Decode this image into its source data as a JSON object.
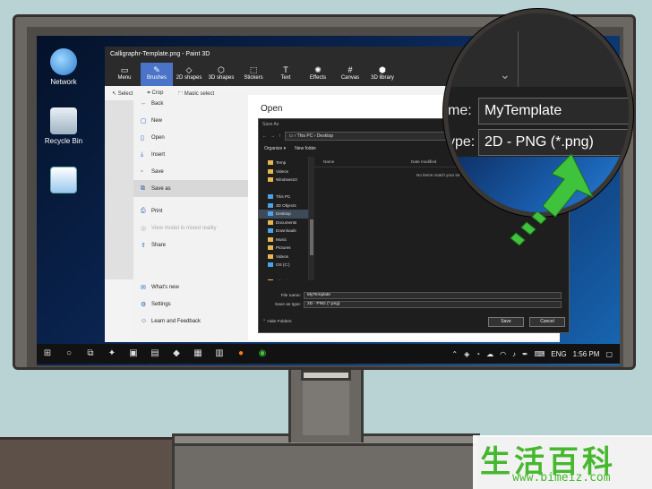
{
  "desktop": {
    "icons": [
      {
        "label": "Network"
      },
      {
        "label": "Recycle Bin"
      },
      {
        "label": ""
      }
    ]
  },
  "paint3d": {
    "title": "Calligraphr-Template.png - Paint 3D",
    "ribbon": [
      {
        "label": "Menu",
        "icon": "folder-icon"
      },
      {
        "label": "Brushes",
        "icon": "brush-icon",
        "active": true
      },
      {
        "label": "2D shapes",
        "icon": "shapes-icon"
      },
      {
        "label": "3D shapes",
        "icon": "cube-icon"
      },
      {
        "label": "Stickers",
        "icon": "sticker-icon"
      },
      {
        "label": "Text",
        "icon": "text-icon"
      },
      {
        "label": "Effects",
        "icon": "effects-icon"
      },
      {
        "label": "Canvas",
        "icon": "canvas-icon"
      },
      {
        "label": "3D library",
        "icon": "library-icon"
      }
    ],
    "tools": {
      "select": "Select",
      "crop": "Crop",
      "magic_select": "Magic select"
    }
  },
  "file_menu": {
    "items": [
      {
        "label": "Back",
        "icon": "back-arrow-icon"
      },
      {
        "label": "New",
        "icon": "new-file-icon"
      },
      {
        "label": "Open",
        "icon": "open-file-icon"
      },
      {
        "label": "Insert",
        "icon": "insert-icon"
      },
      {
        "label": "Save",
        "icon": "save-icon"
      },
      {
        "label": "Save as",
        "icon": "save-as-icon",
        "active": true
      },
      {
        "label": "Print",
        "icon": "print-icon"
      },
      {
        "label": "View model in mixed reality",
        "icon": "mixed-reality-icon",
        "disabled": true
      },
      {
        "label": "Share",
        "icon": "share-icon"
      },
      {
        "label": "What's new",
        "icon": "whats-new-icon"
      },
      {
        "label": "Settings",
        "icon": "settings-icon"
      },
      {
        "label": "Learn and Feedback",
        "icon": "feedback-icon"
      }
    ],
    "open_panel_title": "Open"
  },
  "save_dialog": {
    "title": "Save As",
    "path": [
      "This PC",
      "Desktop"
    ],
    "toolbar": {
      "organize": "Organize ▾",
      "new_folder": "New folder"
    },
    "nav": [
      {
        "label": "Temp",
        "kind": "folder"
      },
      {
        "label": "Videos",
        "kind": "folder"
      },
      {
        "label": "Windows10",
        "kind": "folder"
      },
      {
        "label": "",
        "kind": "spacer"
      },
      {
        "label": "This PC",
        "kind": "pc"
      },
      {
        "label": "3D Objects",
        "kind": "blue"
      },
      {
        "label": "Desktop",
        "kind": "blue",
        "selected": true
      },
      {
        "label": "Documents",
        "kind": "folder"
      },
      {
        "label": "Downloads",
        "kind": "blue"
      },
      {
        "label": "Music",
        "kind": "folder"
      },
      {
        "label": "Pictures",
        "kind": "folder"
      },
      {
        "label": "Videos",
        "kind": "folder"
      },
      {
        "label": "OS (C:)",
        "kind": "blue"
      },
      {
        "label": "",
        "kind": "spacer"
      },
      {
        "label": "Libraries",
        "kind": "folder"
      }
    ],
    "columns": {
      "name": "Name",
      "date_modified": "Date modified"
    },
    "empty_message": "No items match your se",
    "file_name_label": "File name:",
    "file_name_value": "MyTemplate",
    "save_type_label": "Save as type:",
    "save_type_value": "2D - PNG (*.png)",
    "hide_folders": "Hide Folders",
    "save_button": "Save",
    "cancel_button": "Cancel"
  },
  "taskbar": {
    "language": "ENG",
    "time": "1:56 PM"
  },
  "magnifier": {
    "name_label": "me:",
    "name_value": "MyTemplate",
    "type_label": "ype:",
    "type_value": "2D - PNG (*.png)"
  },
  "watermark": {
    "chinese": "生活百科",
    "url": "www.bimeiz.com"
  },
  "colors": {
    "accent_ribbon": "#4b74c8",
    "arrow_green": "#3fc23c",
    "watermark_green": "#46b82e"
  }
}
